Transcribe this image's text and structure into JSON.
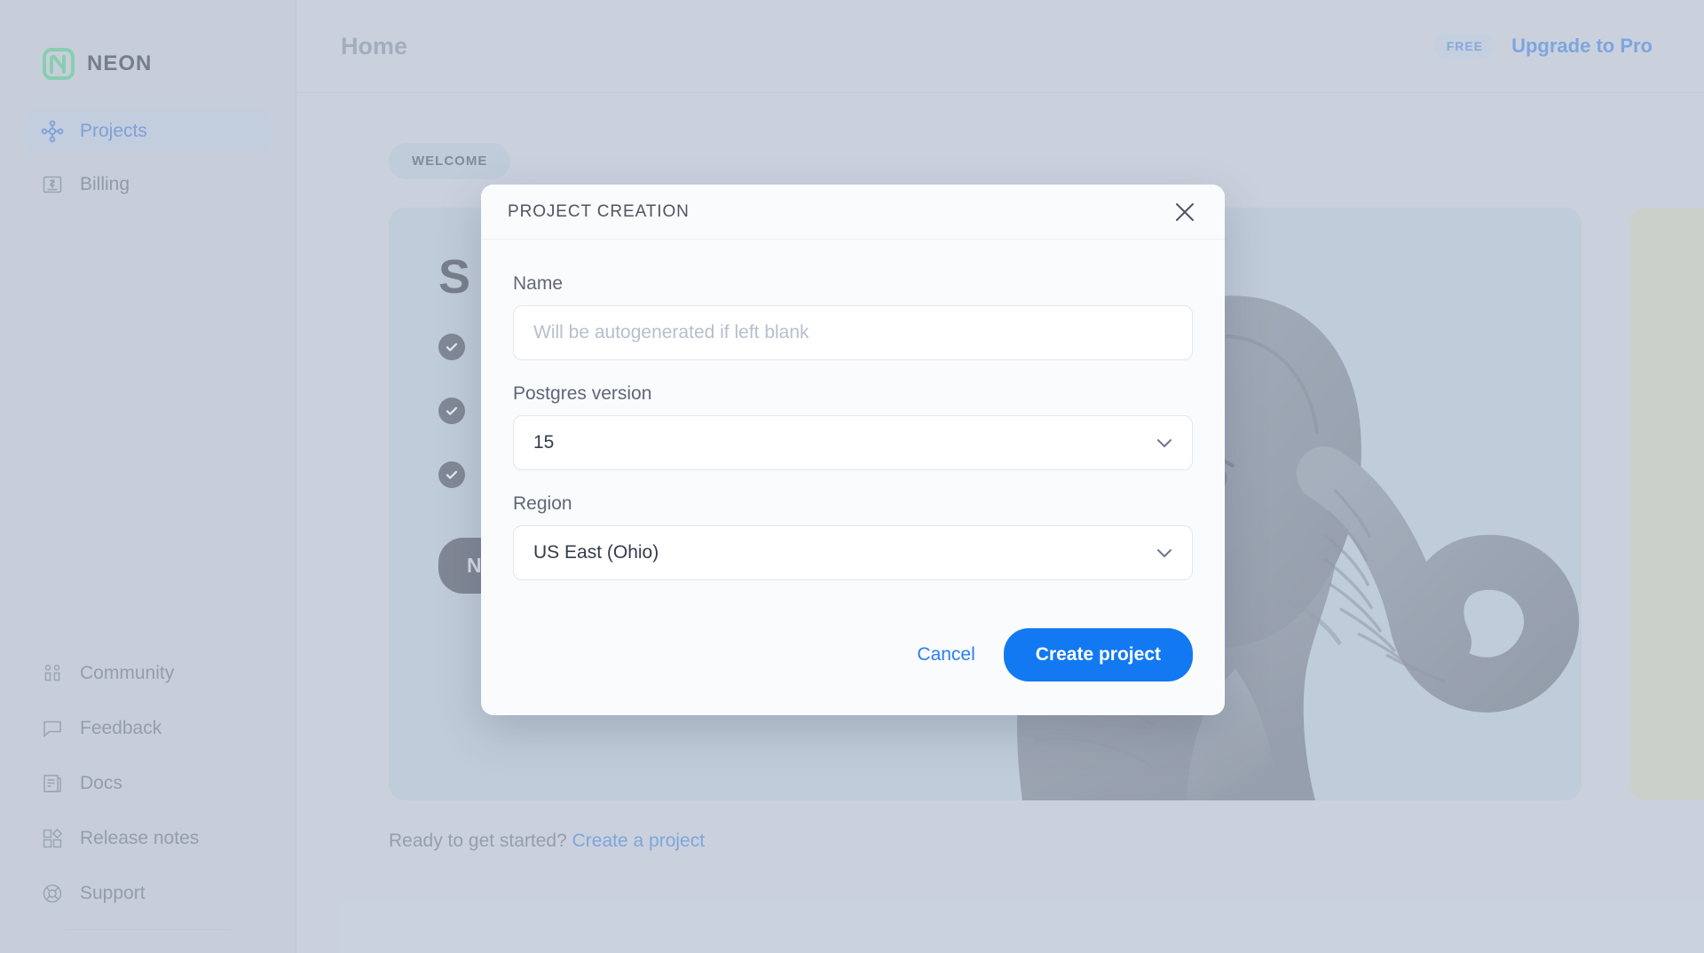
{
  "brand": {
    "logo_text": "NEON",
    "logo_icon": "neon-logo-icon",
    "accent_blue": "#4887e0",
    "primary_blue": "#1279f2",
    "logo_green": "#5bcd8e"
  },
  "sidebar": {
    "primary_items": [
      {
        "label": "Projects",
        "icon": "projects-icon",
        "active": true
      },
      {
        "label": "Billing",
        "icon": "billing-icon",
        "active": false
      }
    ],
    "secondary_items": [
      {
        "label": "Community",
        "icon": "community-icon"
      },
      {
        "label": "Feedback",
        "icon": "feedback-icon"
      },
      {
        "label": "Docs",
        "icon": "docs-icon"
      },
      {
        "label": "Release notes",
        "icon": "release-notes-icon"
      },
      {
        "label": "Support",
        "icon": "support-icon"
      }
    ]
  },
  "topbar": {
    "title": "Home",
    "plan_badge": "FREE",
    "upgrade_label": "Upgrade to Pro"
  },
  "content": {
    "welcome_badge": "WELCOME",
    "card_heading": "S\nP",
    "next_button": "Next: Branching",
    "footer_prompt": "Ready to get started?",
    "footer_link": "Create a project",
    "elephant_icon": "elephant-illustration"
  },
  "modal": {
    "title": "PROJECT CREATION",
    "close_icon": "close-icon",
    "fields": {
      "name": {
        "label": "Name",
        "value": "",
        "placeholder": "Will be autogenerated if left blank"
      },
      "postgres_version": {
        "label": "Postgres version",
        "value": "15",
        "caret_icon": "chevron-down-icon"
      },
      "region": {
        "label": "Region",
        "value": "US East (Ohio)",
        "caret_icon": "chevron-down-icon"
      }
    },
    "cancel_label": "Cancel",
    "submit_label": "Create project"
  }
}
